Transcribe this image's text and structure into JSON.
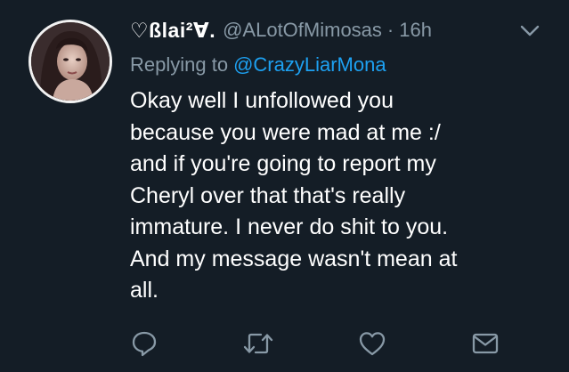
{
  "tweet": {
    "display_name": "♡ßlai²Ɐ.",
    "handle": "@ALotOfMimosas",
    "separator": "·",
    "time": "16h",
    "reply_prefix": "Replying to",
    "reply_to": "@CrazyLiarMona",
    "body_lines": [
      "Okay well I unfollowed you",
      "because you were mad at me :/",
      "and if you're going to report my",
      "Cheryl over that that's really",
      "immature. I never do shit to you.",
      "And my message wasn't mean at",
      "all."
    ]
  },
  "icons": {
    "menu": "chevron-down-icon",
    "reply": "reply-icon",
    "retweet": "retweet-icon",
    "like": "heart-icon",
    "message": "envelope-icon"
  },
  "colors": {
    "background": "#141d26",
    "primary_text": "#ffffff",
    "secondary_text": "#8899a6",
    "link": "#1da1f2"
  }
}
